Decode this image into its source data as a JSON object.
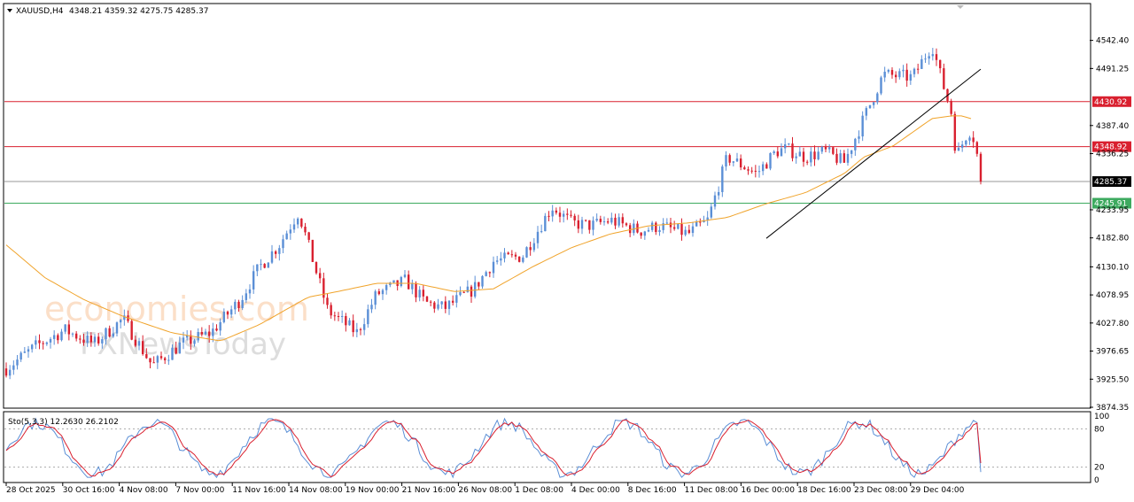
{
  "header": {
    "symbol": "XAUUSD,H4",
    "ohlc": "4348.21 4359.32 4275.75 4285.37"
  },
  "watermark": {
    "line1": "economies.com",
    "line2": "FXNewsToday"
  },
  "colors": {
    "up": "#5b8fd6",
    "down": "#d9202f",
    "ma": "#f0a32a",
    "resistance": "#d9202f",
    "support": "#3daa5f",
    "current": "#9a9a9a",
    "stoch_main": "#5b8fd6",
    "stoch_signal": "#d9202f"
  },
  "chart_data": {
    "type": "candlestick",
    "instrument": "XAUUSD",
    "timeframe": "H4",
    "last": {
      "open": 4348.21,
      "high": 4359.32,
      "low": 4275.75,
      "close": 4285.37
    },
    "y_ticks": [
      "4542.40",
      "4491.25",
      "4387.40",
      "4336.25",
      "4233.95",
      "4182.80",
      "4130.10",
      "4078.95",
      "4027.80",
      "3976.65",
      "3925.50",
      "3874.35"
    ],
    "ylim": [
      3874.35,
      4595
    ],
    "x_ticks": [
      "28 Oct 2025",
      "30 Oct 16:00",
      "4 Nov 08:00",
      "7 Nov 00:00",
      "11 Nov 16:00",
      "14 Nov 08:00",
      "19 Nov 00:00",
      "21 Nov 16:00",
      "26 Nov 08:00",
      "1 Dec 08:00",
      "4 Dec 00:00",
      "8 Dec 16:00",
      "11 Dec 08:00",
      "16 Dec 00:00",
      "18 Dec 16:00",
      "23 Dec 08:00",
      "29 Dec 04:00"
    ],
    "horizontal_levels": [
      {
        "label": "4430.92",
        "value": 4430.92,
        "kind": "resistance"
      },
      {
        "label": "4348.92",
        "value": 4348.92,
        "kind": "resistance"
      },
      {
        "label": "4285.37",
        "value": 4285.37,
        "kind": "current"
      },
      {
        "label": "4245.91",
        "value": 4245.91,
        "kind": "support"
      }
    ],
    "trendline": {
      "x": [
        0.78,
        1.0
      ],
      "y": [
        4182.0,
        4490.0
      ]
    },
    "series": [
      {
        "kind": "price",
        "x": [
          0.0,
          0.03,
          0.06,
          0.09,
          0.12,
          0.15,
          0.18,
          0.21,
          0.24,
          0.26,
          0.28,
          0.3,
          0.33,
          0.36,
          0.38,
          0.41,
          0.43,
          0.45,
          0.48,
          0.5,
          0.53,
          0.56,
          0.58,
          0.6,
          0.62,
          0.65,
          0.67,
          0.7,
          0.72,
          0.74,
          0.77,
          0.79,
          0.8,
          0.82,
          0.84,
          0.86,
          0.88,
          0.9,
          0.93,
          0.95,
          0.96,
          0.97,
          0.975,
          0.985,
          0.99,
          0.995,
          1.0
        ],
        "y": [
          3945,
          3985,
          4015,
          3990,
          4035,
          3950,
          3990,
          4010,
          4070,
          4130,
          4170,
          4230,
          4050,
          4010,
          4080,
          4105,
          4065,
          4055,
          4090,
          4140,
          4150,
          4240,
          4210,
          4205,
          4215,
          4195,
          4205,
          4190,
          4215,
          4330,
          4300,
          4340,
          4345,
          4330,
          4340,
          4320,
          4400,
          4480,
          4475,
          4535,
          4470,
          4410,
          4330,
          4370,
          4380,
          4350,
          4285
        ]
      },
      {
        "kind": "ma",
        "x": [
          0.0,
          0.04,
          0.08,
          0.12,
          0.17,
          0.22,
          0.26,
          0.31,
          0.34,
          0.38,
          0.42,
          0.46,
          0.5,
          0.54,
          0.58,
          0.62,
          0.66,
          0.7,
          0.74,
          0.78,
          0.82,
          0.86,
          0.88,
          0.91,
          0.93,
          0.95,
          0.97,
          0.98,
          0.99
        ],
        "y": [
          4170,
          4110,
          4070,
          4040,
          4010,
          3995,
          4025,
          4075,
          4085,
          4100,
          4100,
          4085,
          4090,
          4130,
          4165,
          4190,
          4205,
          4210,
          4220,
          4245,
          4265,
          4300,
          4330,
          4350,
          4375,
          4400,
          4405,
          4405,
          4400
        ]
      }
    ],
    "stochastic": {
      "label": "Sto(5,3,3) 12.2630 26.2102",
      "main_last": 12.263,
      "signal_last": 26.2102,
      "levels": [
        "100",
        "80",
        "20",
        "0"
      ],
      "ylim": [
        0,
        100
      ]
    }
  }
}
